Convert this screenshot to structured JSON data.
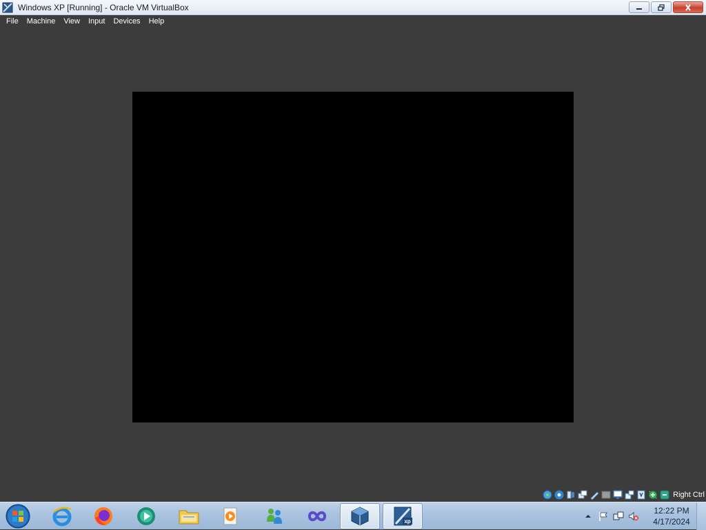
{
  "window": {
    "title": "Windows XP [Running] - Oracle VM VirtualBox",
    "icon": "virtualbox-xp-icon"
  },
  "menu": {
    "items": [
      {
        "label": "File"
      },
      {
        "label": "Machine"
      },
      {
        "label": "View"
      },
      {
        "label": "Input"
      },
      {
        "label": "Devices"
      },
      {
        "label": "Help"
      }
    ]
  },
  "statusbar": {
    "icons": [
      "hard-disk-icon",
      "optical-drive-icon",
      "audio-icon",
      "network-icon",
      "usb-icon",
      "shared-folders-icon",
      "display-icon",
      "video-capture-icon",
      "cpu-icon",
      "mouse-integration-icon",
      "keyboard-icon"
    ],
    "host_key": "Right Ctrl"
  },
  "taskbar": {
    "apps": [
      {
        "name": "internet-explorer"
      },
      {
        "name": "firefox"
      },
      {
        "name": "media-player"
      },
      {
        "name": "file-explorer"
      },
      {
        "name": "vlc-media"
      },
      {
        "name": "messenger"
      },
      {
        "name": "visual-studio"
      },
      {
        "name": "virtualbox-manager"
      },
      {
        "name": "virtualbox-xp-vm"
      }
    ],
    "clock": {
      "time": "12:22 PM",
      "date": "4/17/2024"
    }
  },
  "colors": {
    "background": "#3c3c3d",
    "vm_screen": "#000000",
    "taskbar": "#a9c2de"
  }
}
